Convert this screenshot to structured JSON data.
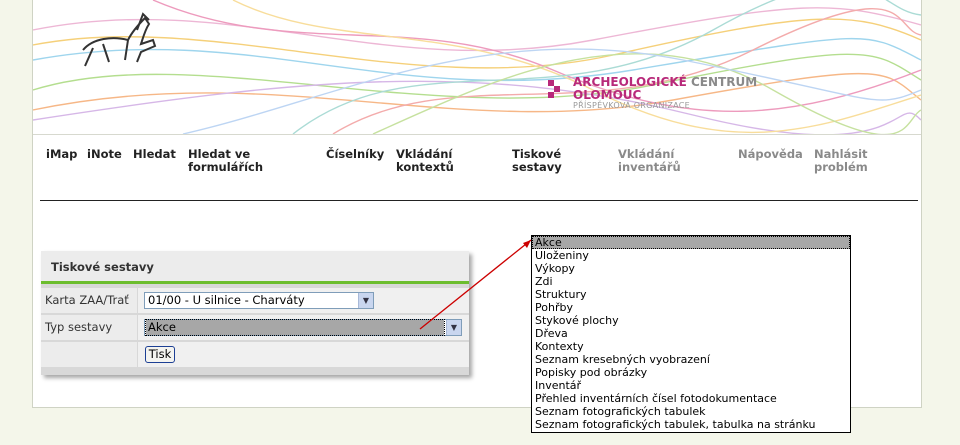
{
  "logo": {
    "line1_accent": "ARCHEOLOGICKÉ",
    "line1_rest": "CENTRUM",
    "line2": "OLOMOUC",
    "line3": "PŘÍSPĚVKOVÁ ORGANIZACE"
  },
  "nav": {
    "items": [
      {
        "label": "iMap"
      },
      {
        "label": "iNote"
      },
      {
        "label": "Hledat"
      },
      {
        "label": "Hledat ve\nformulářích"
      },
      {
        "label": "Číselníky"
      },
      {
        "label": "Vkládání\nkontextů"
      },
      {
        "label": "Tiskové\nsestavy"
      },
      {
        "label": "Vkládání\ninventářů"
      },
      {
        "label": "Nápověda"
      },
      {
        "label": "Nahlásit\nproblém"
      }
    ]
  },
  "form": {
    "title": "Tiskové sestavy",
    "karta_label": "Karta ZAA/Trať",
    "karta_value": "01/00 - U silnice - Charváty",
    "typ_label": "Typ sestavy",
    "typ_value": "Akce",
    "submit_label": "Tisk"
  },
  "dropdown": {
    "selected_index": 0,
    "options": [
      "Akce",
      "Uloženiny",
      "Výkopy",
      "Zdi",
      "Struktury",
      "Pohřby",
      "Stykové plochy",
      "Dřeva",
      "Kontexty",
      "Seznam kresebných vyobrazení",
      "Popisky pod obrázky",
      "Inventář",
      "Přehled inventárních čísel fotodokumentace",
      "Seznam fotografických tabulek",
      "Seznam fotografických tabulek, tabulka na stránku"
    ]
  },
  "colors": {
    "brand_magenta": "#b8297a",
    "accent_green": "#6cbd2e",
    "page_background": "#f4f6ea",
    "annotation_arrow": "#cc0000"
  }
}
